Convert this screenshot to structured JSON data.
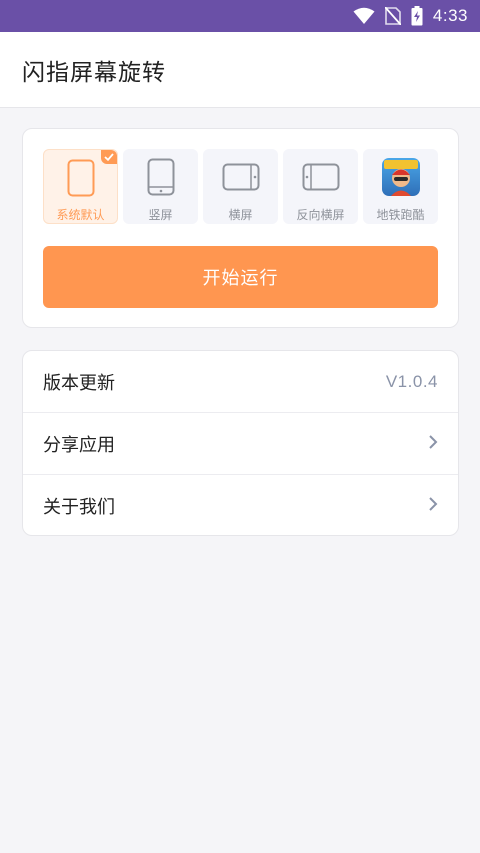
{
  "statusbar": {
    "time": "4:33",
    "icons": [
      "wifi-icon",
      "no-sim-icon",
      "battery-charging-icon"
    ]
  },
  "appbar": {
    "title": "闪指屏幕旋转"
  },
  "modes": [
    {
      "label": "系统默认",
      "icon": "phone-portrait-icon",
      "selected": true
    },
    {
      "label": "竖屏",
      "icon": "phone-portrait-icon",
      "selected": false
    },
    {
      "label": "横屏",
      "icon": "phone-landscape-icon",
      "selected": false
    },
    {
      "label": "反向横屏",
      "icon": "phone-landscape-reverse-icon",
      "selected": false
    },
    {
      "label": "地铁跑酷",
      "icon": "subway-surfers-app-icon",
      "selected": false
    }
  ],
  "start_button": {
    "label": "开始运行"
  },
  "settings": {
    "version_label": "版本更新",
    "version_value": "V1.0.4",
    "share_label": "分享应用",
    "about_label": "关于我们"
  },
  "colors": {
    "statusbar": "#6a50a7",
    "accent": "#ff9650",
    "selected_bg": "#fff2e8",
    "muted": "#8e929a"
  }
}
